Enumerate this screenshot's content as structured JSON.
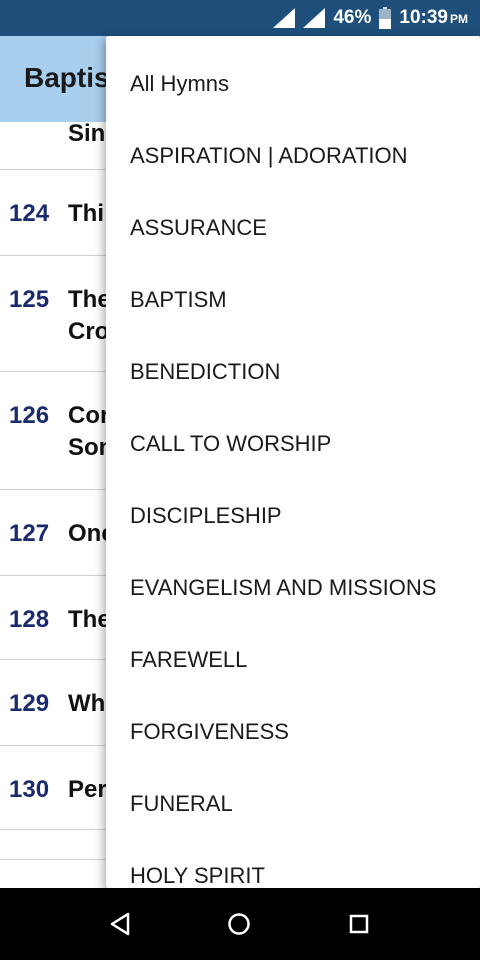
{
  "status_bar": {
    "battery": "46%",
    "time": "10:39",
    "ampm": "PM",
    "icons": [
      "signal-icon",
      "signal-icon",
      "battery-icon"
    ]
  },
  "app_bar": {
    "title": "Baptism"
  },
  "hymns": [
    {
      "number": "",
      "title": "Sin"
    },
    {
      "number": "124",
      "title": "Thi"
    },
    {
      "number": "125",
      "title": "The",
      "title2": "Cro"
    },
    {
      "number": "126",
      "title": "Cor",
      "title2": "Son"
    },
    {
      "number": "127",
      "title": "One"
    },
    {
      "number": "128",
      "title": "The"
    },
    {
      "number": "129",
      "title": "Wh"
    },
    {
      "number": "130",
      "title": "Per"
    }
  ],
  "menu": {
    "items": [
      "All Hymns",
      "ASPIRATION | ADORATION",
      "ASSURANCE",
      "BAPTISM",
      "BENEDICTION",
      "CALL TO WORSHIP",
      "DISCIPLESHIP",
      "EVANGELISM AND MISSIONS",
      "FAREWELL",
      "FORGIVENESS",
      "FUNERAL",
      "HOLY SPIRIT"
    ]
  },
  "nav_bar": {
    "icons": [
      "back-icon",
      "home-icon",
      "recents-icon"
    ]
  },
  "colors": {
    "status_bar": "#1d4f7a",
    "app_bar": "#a9cfee",
    "hymn_number": "#1b2a6e"
  }
}
